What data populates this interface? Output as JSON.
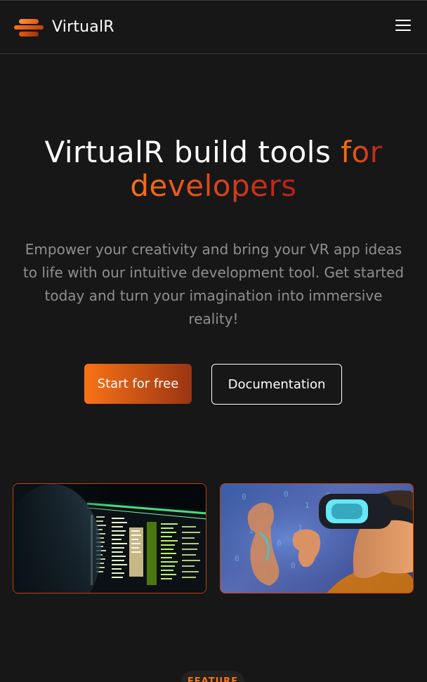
{
  "navbar": {
    "brand_name": "VirtualR",
    "logo_icon": "virtualr-logo-icon",
    "menu_icon": "hamburger-menu-icon"
  },
  "hero": {
    "title_main": "VirtualR build tools ",
    "title_accent_1": "for",
    "title_accent_2": "developers",
    "subtitle": "Empower your creativity and bring your VR app ideas to life with our intuitive development tool. Get started today and turn your imagination into immersive reality!",
    "primary_button": "Start for free",
    "secondary_button": "Documentation"
  },
  "images": [
    {
      "name": "code-screen-image"
    },
    {
      "name": "vr-headset-user-image"
    }
  ],
  "feature_badge": "FEATURE",
  "colors": {
    "background": "#171717",
    "accent_start": "#f97316",
    "accent_end": "#9a3412",
    "muted_text": "#8f8f8f"
  }
}
